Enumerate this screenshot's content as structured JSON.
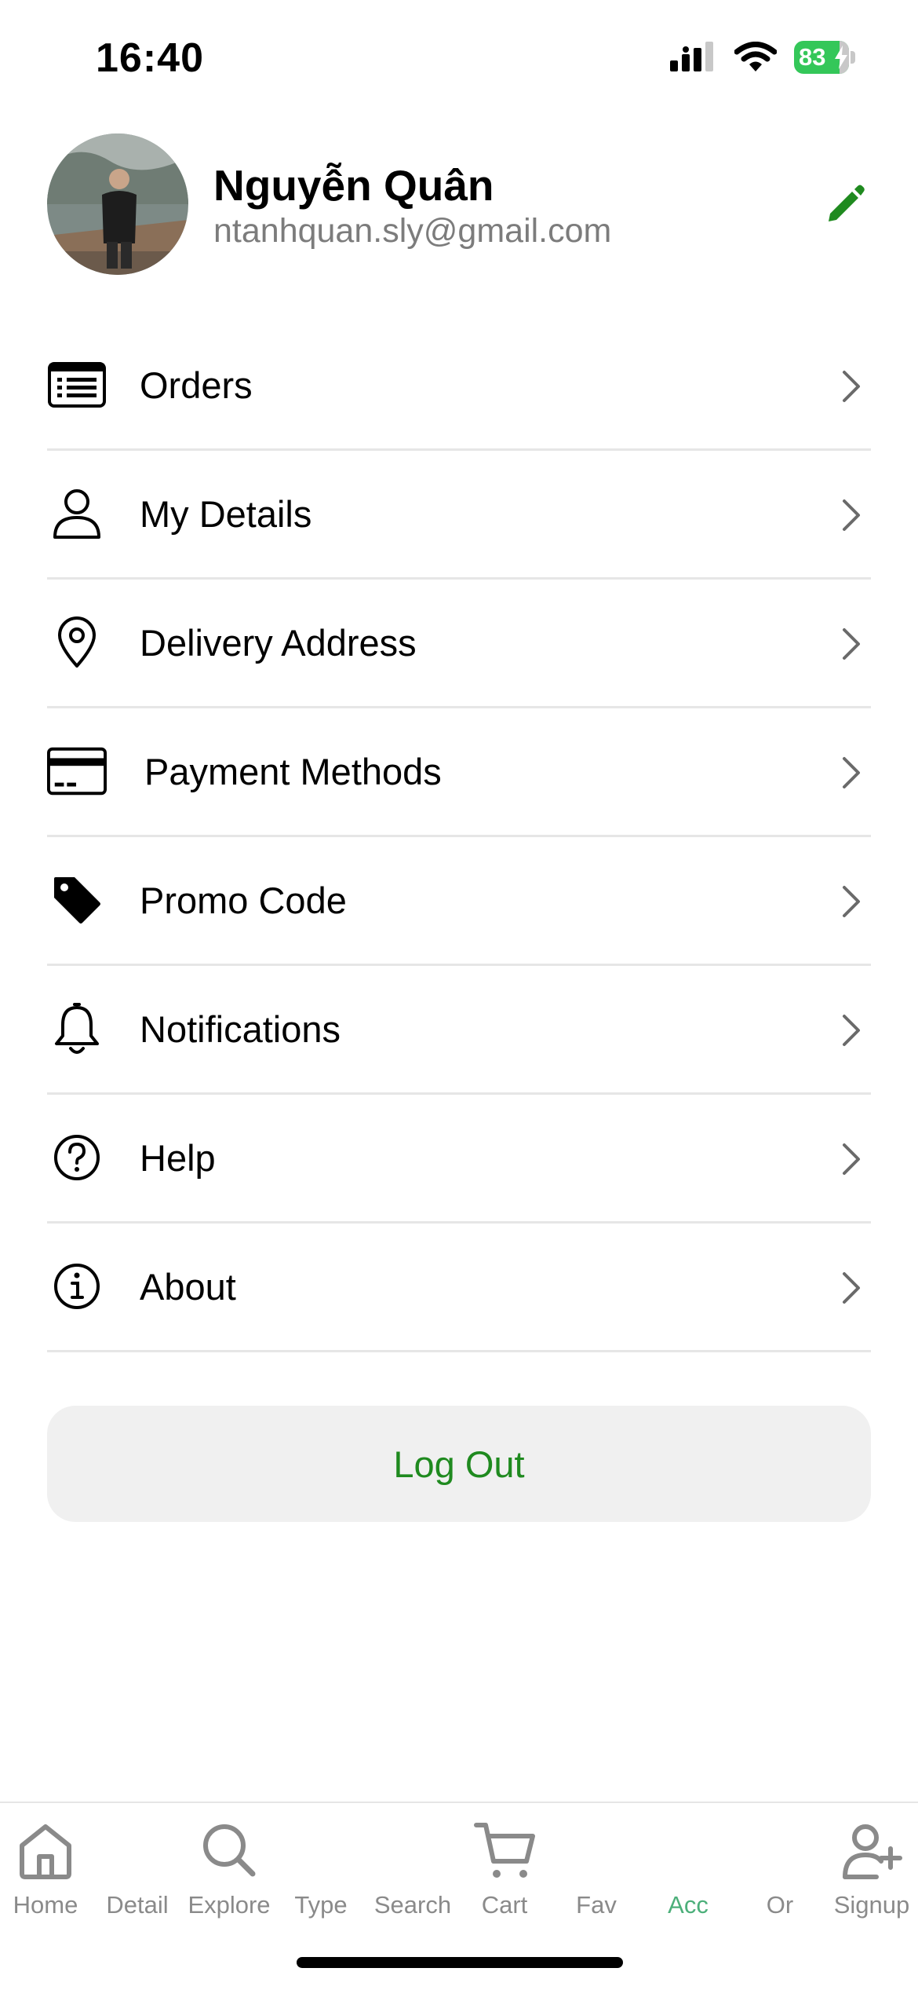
{
  "status_bar": {
    "time": "16:40",
    "battery": "83"
  },
  "profile": {
    "name": "Nguyễn Quân",
    "email": "ntanhquan.sly@gmail.com"
  },
  "menu": [
    {
      "label": "Orders",
      "icon": "orders-icon"
    },
    {
      "label": "My Details",
      "icon": "user-icon"
    },
    {
      "label": "Delivery Address",
      "icon": "location-pin-icon"
    },
    {
      "label": "Payment Methods",
      "icon": "credit-card-icon"
    },
    {
      "label": "Promo Code",
      "icon": "tag-icon"
    },
    {
      "label": "Notifications",
      "icon": "bell-icon"
    },
    {
      "label": "Help",
      "icon": "help-circle-icon"
    },
    {
      "label": "About",
      "icon": "info-circle-icon"
    }
  ],
  "logout_label": "Log Out",
  "tabs": [
    {
      "label": "Home",
      "icon": "home-icon"
    },
    {
      "label": "Detail"
    },
    {
      "label": "Explore",
      "icon": "search-icon"
    },
    {
      "label": "Type"
    },
    {
      "label": "Search"
    },
    {
      "label": "Cart",
      "icon": "cart-icon"
    },
    {
      "label": "Fav"
    },
    {
      "label": "Acc",
      "active": true
    },
    {
      "label": "Or"
    },
    {
      "label": "Signup",
      "icon": "add-user-icon"
    }
  ],
  "colors": {
    "accent_green": "#1f8a1f",
    "active_tab": "#4caf7a",
    "inactive_tab": "#8a8a8a",
    "divider": "#e6e6e6",
    "logout_bg": "#f0f0f0",
    "battery": "#34c759"
  }
}
